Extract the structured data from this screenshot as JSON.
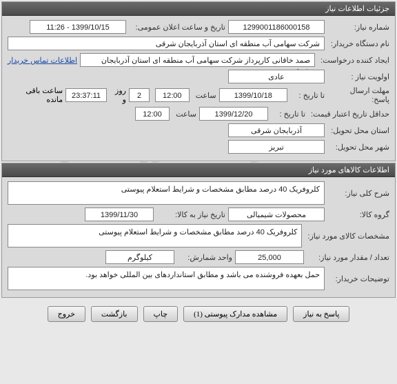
{
  "watermark": {
    "line1": "سامانه تدارکات الکترونیکی دولت",
    "line2": "۰۲۱-۸۸۳۴۹۶۷۰-۵"
  },
  "panel1": {
    "title": "جزئیات اطلاعات نیاز",
    "need_number_label": "شماره نیاز:",
    "need_number": "1299001186000158",
    "announce_label": "تاریخ و ساعت اعلان عمومی:",
    "announce_value": "1399/10/15 - 11:26",
    "buyer_org_label": "نام دستگاه خریدار:",
    "buyer_org": "شرکت سهامی آب منطقه ای استان آذربایجان شرقی",
    "creator_label": "ایجاد کننده درخواست:",
    "creator": "صمد خاقانی کارپرداز شرکت سهامی آب منطقه ای استان آذربایجان شرقی",
    "buyer_contact_link": "اطلاعات تماس خریدار",
    "priority_label": "اولویت نیاز :",
    "priority": "عادی",
    "deadline_label": "مهلت ارسال پاسخ:",
    "until_label": "تا تاریخ :",
    "deadline_date": "1399/10/18",
    "time_label": "ساعت",
    "deadline_time": "12:00",
    "remaining_days": "2",
    "days_and_label": "روز و",
    "remaining_time": "23:37:11",
    "remaining_suffix": "ساعت باقی مانده",
    "min_validity_label": "حداقل تاریخ اعتبار قیمت:",
    "min_validity_until": "تا تاریخ :",
    "min_validity_date": "1399/12/20",
    "min_validity_time": "12:00",
    "delivery_province_label": "استان محل تحویل:",
    "delivery_province": "آذربایجان شرقی",
    "delivery_city_label": "شهر محل تحویل:",
    "delivery_city": "تبریز"
  },
  "panel2": {
    "title": "اطلاعات کالاهای مورد نیاز",
    "general_desc_label": "شرح کلی نیاز:",
    "general_desc": "کلروفریک 40 درصد مطابق مشخصات و شرایط استعلام پیوستی",
    "goods_group_label": "گروه کالا:",
    "goods_group": "محصولات شیمیالی",
    "need_by_label": "تاریخ نیاز به کالا:",
    "need_by_date": "1399/11/30",
    "goods_spec_label": "مشخصات کالای مورد نیاز:",
    "goods_spec": "کلروفریک 40 درصد مطابق مشخصات و شرایط استعلام پیوستی",
    "qty_label": "تعداد / مقدار مورد نیاز:",
    "qty": "25,000",
    "unit_label": "واحد شمارش:",
    "unit": "کیلوگرم",
    "buyer_notes_label": "توضیحات خریدار:",
    "buyer_notes": "حمل بعهده فروشنده می باشد و مطابق استانداردهای بین المللی خواهد بود."
  },
  "buttons": {
    "respond": "پاسخ به نیاز",
    "view_attach": "مشاهده مدارک پیوستی (1)",
    "print": "چاپ",
    "back": "بازگشت",
    "exit": "خروج"
  }
}
